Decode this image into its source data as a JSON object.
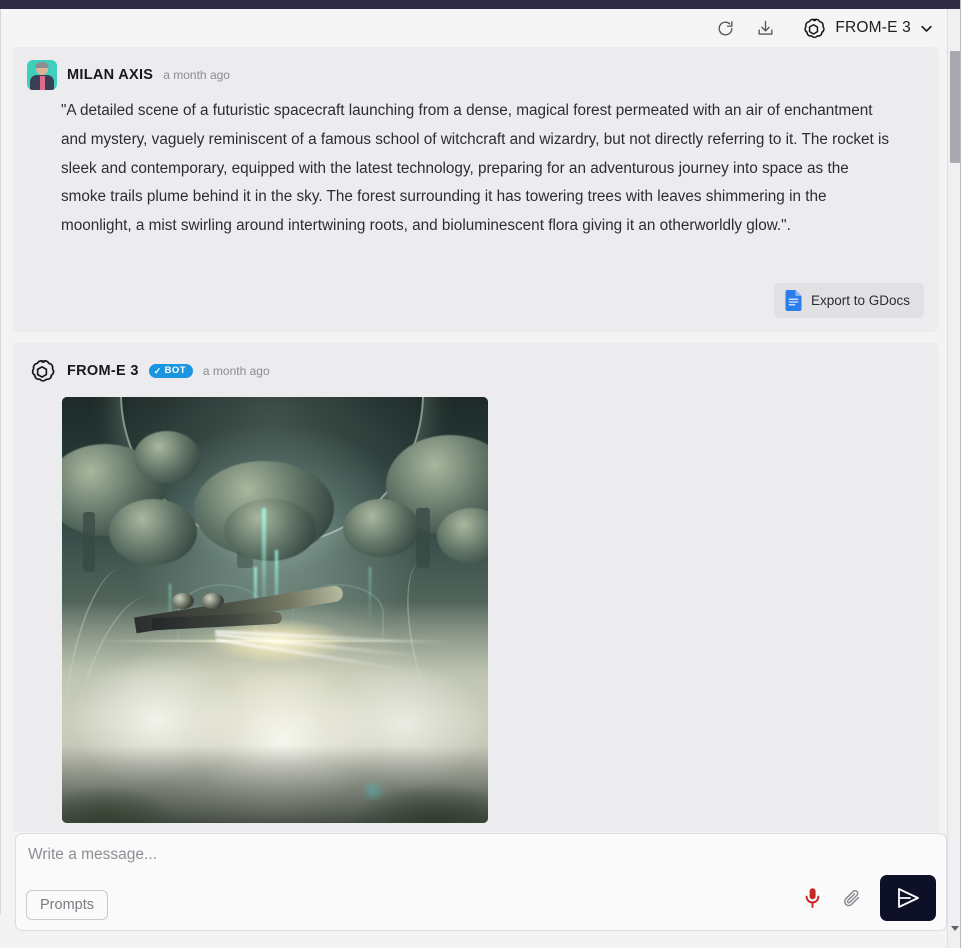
{
  "header": {
    "refresh_icon": "refresh-icon",
    "download_icon": "download-icon",
    "brand_logo_icon": "openai-logo-icon",
    "brand_name": "FROM-E 3",
    "chevron_icon": "chevron-down-icon"
  },
  "messages": [
    {
      "sender": "MILAN AXIS",
      "timestamp": "a month ago",
      "avatar": "user-photo-avatar",
      "is_bot": false,
      "text": "\"A detailed scene of a futuristic spacecraft launching from a dense, magical forest permeated with an air of enchantment and mystery, vaguely reminiscent of a famous school of witchcraft and wizardry, but not directly referring to it. The rocket is sleek and contemporary, equipped with the latest technology, preparing for an adventurous journey into space as the smoke trails plume behind it in the sky. The forest surrounding it has towering trees with leaves shimmering in the moonlight, a mist swirling around intertwining roots, and bioluminescent flora giving it an otherworldly glow.\".",
      "export_button": {
        "label": "Export to GDocs",
        "icon": "google-docs-icon"
      }
    },
    {
      "sender": "FROM-E 3",
      "timestamp": "a month ago",
      "avatar": "openai-logo-icon",
      "is_bot": true,
      "badge": {
        "check": "✓",
        "label": "BOT"
      },
      "image_alt": "generated-image-futuristic-spacecraft-launching-from-magical-forest"
    }
  ],
  "composer": {
    "placeholder": "Write a message...",
    "value": "",
    "prompts_label": "Prompts",
    "mic_icon": "microphone-icon",
    "attach_icon": "paperclip-icon",
    "send_icon": "send-paper-plane-icon"
  },
  "colors": {
    "accent_dark": "#0e1028",
    "top_strip": "#302b45",
    "bot_badge": "#1b95e0",
    "mic_red": "#c62828",
    "gdocs_blue": "#2b7de9",
    "page_bg": "#f3f3f4",
    "bubble_bg": "#ececee"
  }
}
